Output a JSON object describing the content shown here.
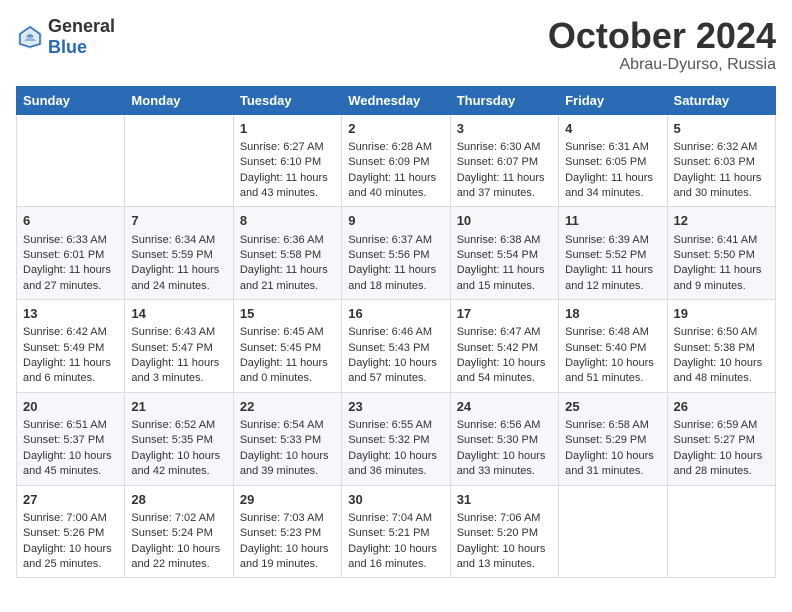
{
  "logo": {
    "general": "General",
    "blue": "Blue"
  },
  "header": {
    "month": "October 2024",
    "location": "Abrau-Dyurso, Russia"
  },
  "weekdays": [
    "Sunday",
    "Monday",
    "Tuesday",
    "Wednesday",
    "Thursday",
    "Friday",
    "Saturday"
  ],
  "weeks": [
    [
      {
        "day": "",
        "sunrise": "",
        "sunset": "",
        "daylight": ""
      },
      {
        "day": "",
        "sunrise": "",
        "sunset": "",
        "daylight": ""
      },
      {
        "day": "1",
        "sunrise": "Sunrise: 6:27 AM",
        "sunset": "Sunset: 6:10 PM",
        "daylight": "Daylight: 11 hours and 43 minutes."
      },
      {
        "day": "2",
        "sunrise": "Sunrise: 6:28 AM",
        "sunset": "Sunset: 6:09 PM",
        "daylight": "Daylight: 11 hours and 40 minutes."
      },
      {
        "day": "3",
        "sunrise": "Sunrise: 6:30 AM",
        "sunset": "Sunset: 6:07 PM",
        "daylight": "Daylight: 11 hours and 37 minutes."
      },
      {
        "day": "4",
        "sunrise": "Sunrise: 6:31 AM",
        "sunset": "Sunset: 6:05 PM",
        "daylight": "Daylight: 11 hours and 34 minutes."
      },
      {
        "day": "5",
        "sunrise": "Sunrise: 6:32 AM",
        "sunset": "Sunset: 6:03 PM",
        "daylight": "Daylight: 11 hours and 30 minutes."
      }
    ],
    [
      {
        "day": "6",
        "sunrise": "Sunrise: 6:33 AM",
        "sunset": "Sunset: 6:01 PM",
        "daylight": "Daylight: 11 hours and 27 minutes."
      },
      {
        "day": "7",
        "sunrise": "Sunrise: 6:34 AM",
        "sunset": "Sunset: 5:59 PM",
        "daylight": "Daylight: 11 hours and 24 minutes."
      },
      {
        "day": "8",
        "sunrise": "Sunrise: 6:36 AM",
        "sunset": "Sunset: 5:58 PM",
        "daylight": "Daylight: 11 hours and 21 minutes."
      },
      {
        "day": "9",
        "sunrise": "Sunrise: 6:37 AM",
        "sunset": "Sunset: 5:56 PM",
        "daylight": "Daylight: 11 hours and 18 minutes."
      },
      {
        "day": "10",
        "sunrise": "Sunrise: 6:38 AM",
        "sunset": "Sunset: 5:54 PM",
        "daylight": "Daylight: 11 hours and 15 minutes."
      },
      {
        "day": "11",
        "sunrise": "Sunrise: 6:39 AM",
        "sunset": "Sunset: 5:52 PM",
        "daylight": "Daylight: 11 hours and 12 minutes."
      },
      {
        "day": "12",
        "sunrise": "Sunrise: 6:41 AM",
        "sunset": "Sunset: 5:50 PM",
        "daylight": "Daylight: 11 hours and 9 minutes."
      }
    ],
    [
      {
        "day": "13",
        "sunrise": "Sunrise: 6:42 AM",
        "sunset": "Sunset: 5:49 PM",
        "daylight": "Daylight: 11 hours and 6 minutes."
      },
      {
        "day": "14",
        "sunrise": "Sunrise: 6:43 AM",
        "sunset": "Sunset: 5:47 PM",
        "daylight": "Daylight: 11 hours and 3 minutes."
      },
      {
        "day": "15",
        "sunrise": "Sunrise: 6:45 AM",
        "sunset": "Sunset: 5:45 PM",
        "daylight": "Daylight: 11 hours and 0 minutes."
      },
      {
        "day": "16",
        "sunrise": "Sunrise: 6:46 AM",
        "sunset": "Sunset: 5:43 PM",
        "daylight": "Daylight: 10 hours and 57 minutes."
      },
      {
        "day": "17",
        "sunrise": "Sunrise: 6:47 AM",
        "sunset": "Sunset: 5:42 PM",
        "daylight": "Daylight: 10 hours and 54 minutes."
      },
      {
        "day": "18",
        "sunrise": "Sunrise: 6:48 AM",
        "sunset": "Sunset: 5:40 PM",
        "daylight": "Daylight: 10 hours and 51 minutes."
      },
      {
        "day": "19",
        "sunrise": "Sunrise: 6:50 AM",
        "sunset": "Sunset: 5:38 PM",
        "daylight": "Daylight: 10 hours and 48 minutes."
      }
    ],
    [
      {
        "day": "20",
        "sunrise": "Sunrise: 6:51 AM",
        "sunset": "Sunset: 5:37 PM",
        "daylight": "Daylight: 10 hours and 45 minutes."
      },
      {
        "day": "21",
        "sunrise": "Sunrise: 6:52 AM",
        "sunset": "Sunset: 5:35 PM",
        "daylight": "Daylight: 10 hours and 42 minutes."
      },
      {
        "day": "22",
        "sunrise": "Sunrise: 6:54 AM",
        "sunset": "Sunset: 5:33 PM",
        "daylight": "Daylight: 10 hours and 39 minutes."
      },
      {
        "day": "23",
        "sunrise": "Sunrise: 6:55 AM",
        "sunset": "Sunset: 5:32 PM",
        "daylight": "Daylight: 10 hours and 36 minutes."
      },
      {
        "day": "24",
        "sunrise": "Sunrise: 6:56 AM",
        "sunset": "Sunset: 5:30 PM",
        "daylight": "Daylight: 10 hours and 33 minutes."
      },
      {
        "day": "25",
        "sunrise": "Sunrise: 6:58 AM",
        "sunset": "Sunset: 5:29 PM",
        "daylight": "Daylight: 10 hours and 31 minutes."
      },
      {
        "day": "26",
        "sunrise": "Sunrise: 6:59 AM",
        "sunset": "Sunset: 5:27 PM",
        "daylight": "Daylight: 10 hours and 28 minutes."
      }
    ],
    [
      {
        "day": "27",
        "sunrise": "Sunrise: 7:00 AM",
        "sunset": "Sunset: 5:26 PM",
        "daylight": "Daylight: 10 hours and 25 minutes."
      },
      {
        "day": "28",
        "sunrise": "Sunrise: 7:02 AM",
        "sunset": "Sunset: 5:24 PM",
        "daylight": "Daylight: 10 hours and 22 minutes."
      },
      {
        "day": "29",
        "sunrise": "Sunrise: 7:03 AM",
        "sunset": "Sunset: 5:23 PM",
        "daylight": "Daylight: 10 hours and 19 minutes."
      },
      {
        "day": "30",
        "sunrise": "Sunrise: 7:04 AM",
        "sunset": "Sunset: 5:21 PM",
        "daylight": "Daylight: 10 hours and 16 minutes."
      },
      {
        "day": "31",
        "sunrise": "Sunrise: 7:06 AM",
        "sunset": "Sunset: 5:20 PM",
        "daylight": "Daylight: 10 hours and 13 minutes."
      },
      {
        "day": "",
        "sunrise": "",
        "sunset": "",
        "daylight": ""
      },
      {
        "day": "",
        "sunrise": "",
        "sunset": "",
        "daylight": ""
      }
    ]
  ]
}
